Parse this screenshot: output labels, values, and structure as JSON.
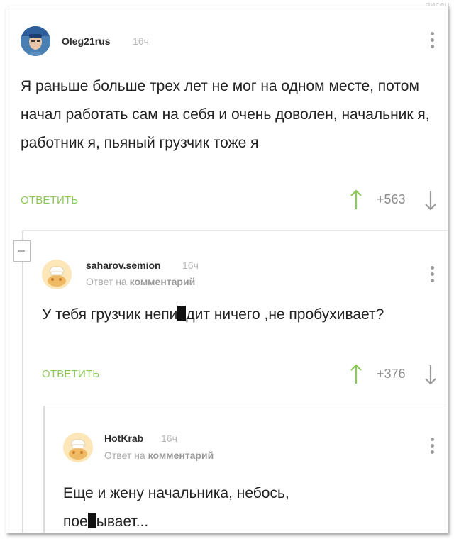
{
  "watermark": "писец",
  "comments": [
    {
      "author": "Oleg21rus",
      "time": "16ч",
      "body": "Я раньше больше трех лет не мог на одном месте, потом начал работать сам на себя и очень доволен, начальник я, работник я, пьяный грузчик тоже я",
      "reply_label": "ОТВЕТИТЬ",
      "rating": "+563"
    },
    {
      "author": "saharov.semion",
      "time": "16ч",
      "reply_prefix": "Ответ на",
      "reply_target": "комментарий",
      "body_part1": "У тебя грузчик непи",
      "body_part2": "дит ничего ,не пробухивает?",
      "reply_label": "ОТВЕТИТЬ",
      "rating": "+376"
    },
    {
      "author": "HotKrab",
      "time": "16ч",
      "reply_prefix": "Ответ на",
      "reply_target": "комментарий",
      "body_line1": "Еще и жену начальника, небось,",
      "body_part1": "пое",
      "body_part2": "ывает..."
    }
  ],
  "colors": {
    "reply_link": "#8ac858",
    "vote_up": "#8ac858",
    "vote_down": "#9a9a9a",
    "text": "#222222",
    "muted": "#b7b7b7"
  },
  "icons": {
    "vote_up": "arrow-up",
    "vote_down": "arrow-down",
    "more": "vertical-dots",
    "collapse": "minus-box",
    "default_avatar": "chef-bun-avatar"
  }
}
